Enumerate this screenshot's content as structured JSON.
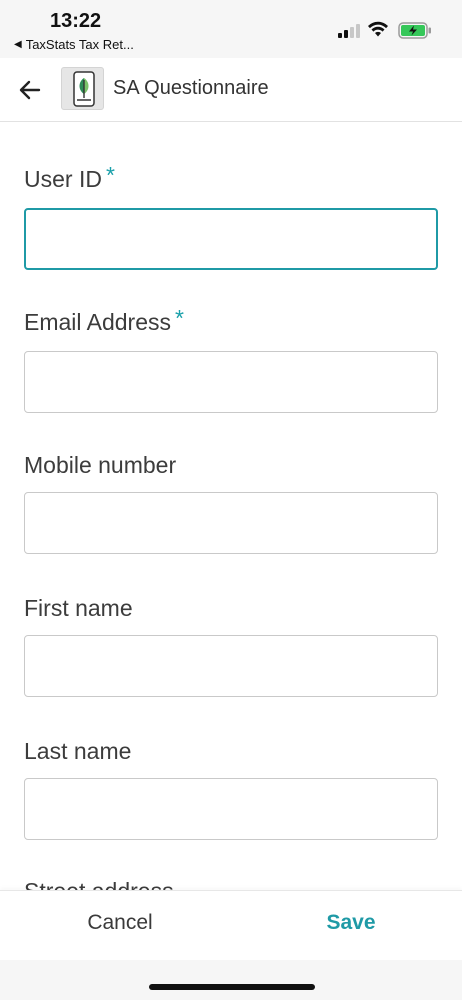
{
  "status_bar": {
    "time": "13:22",
    "back_app_label": "TaxStats Tax Ret...",
    "battery_color": "#35c759"
  },
  "app_bar": {
    "title": "SA Questionnaire",
    "back_icon": "arrow-left-icon",
    "logo_icon": "app-logo-icon"
  },
  "form": {
    "required_marker": "*",
    "fields": [
      {
        "label": "User ID",
        "required": true,
        "value": "",
        "focused": true
      },
      {
        "label": "Email Address",
        "required": true,
        "value": ""
      },
      {
        "label": "Mobile number",
        "required": false,
        "value": ""
      },
      {
        "label": "First name",
        "required": false,
        "value": ""
      },
      {
        "label": "Last name",
        "required": false,
        "value": ""
      },
      {
        "label": "Street address",
        "required": false,
        "value": ""
      }
    ]
  },
  "bottom_bar": {
    "cancel_label": "Cancel",
    "save_label": "Save"
  },
  "colors": {
    "accent": "#1f9aa6"
  }
}
